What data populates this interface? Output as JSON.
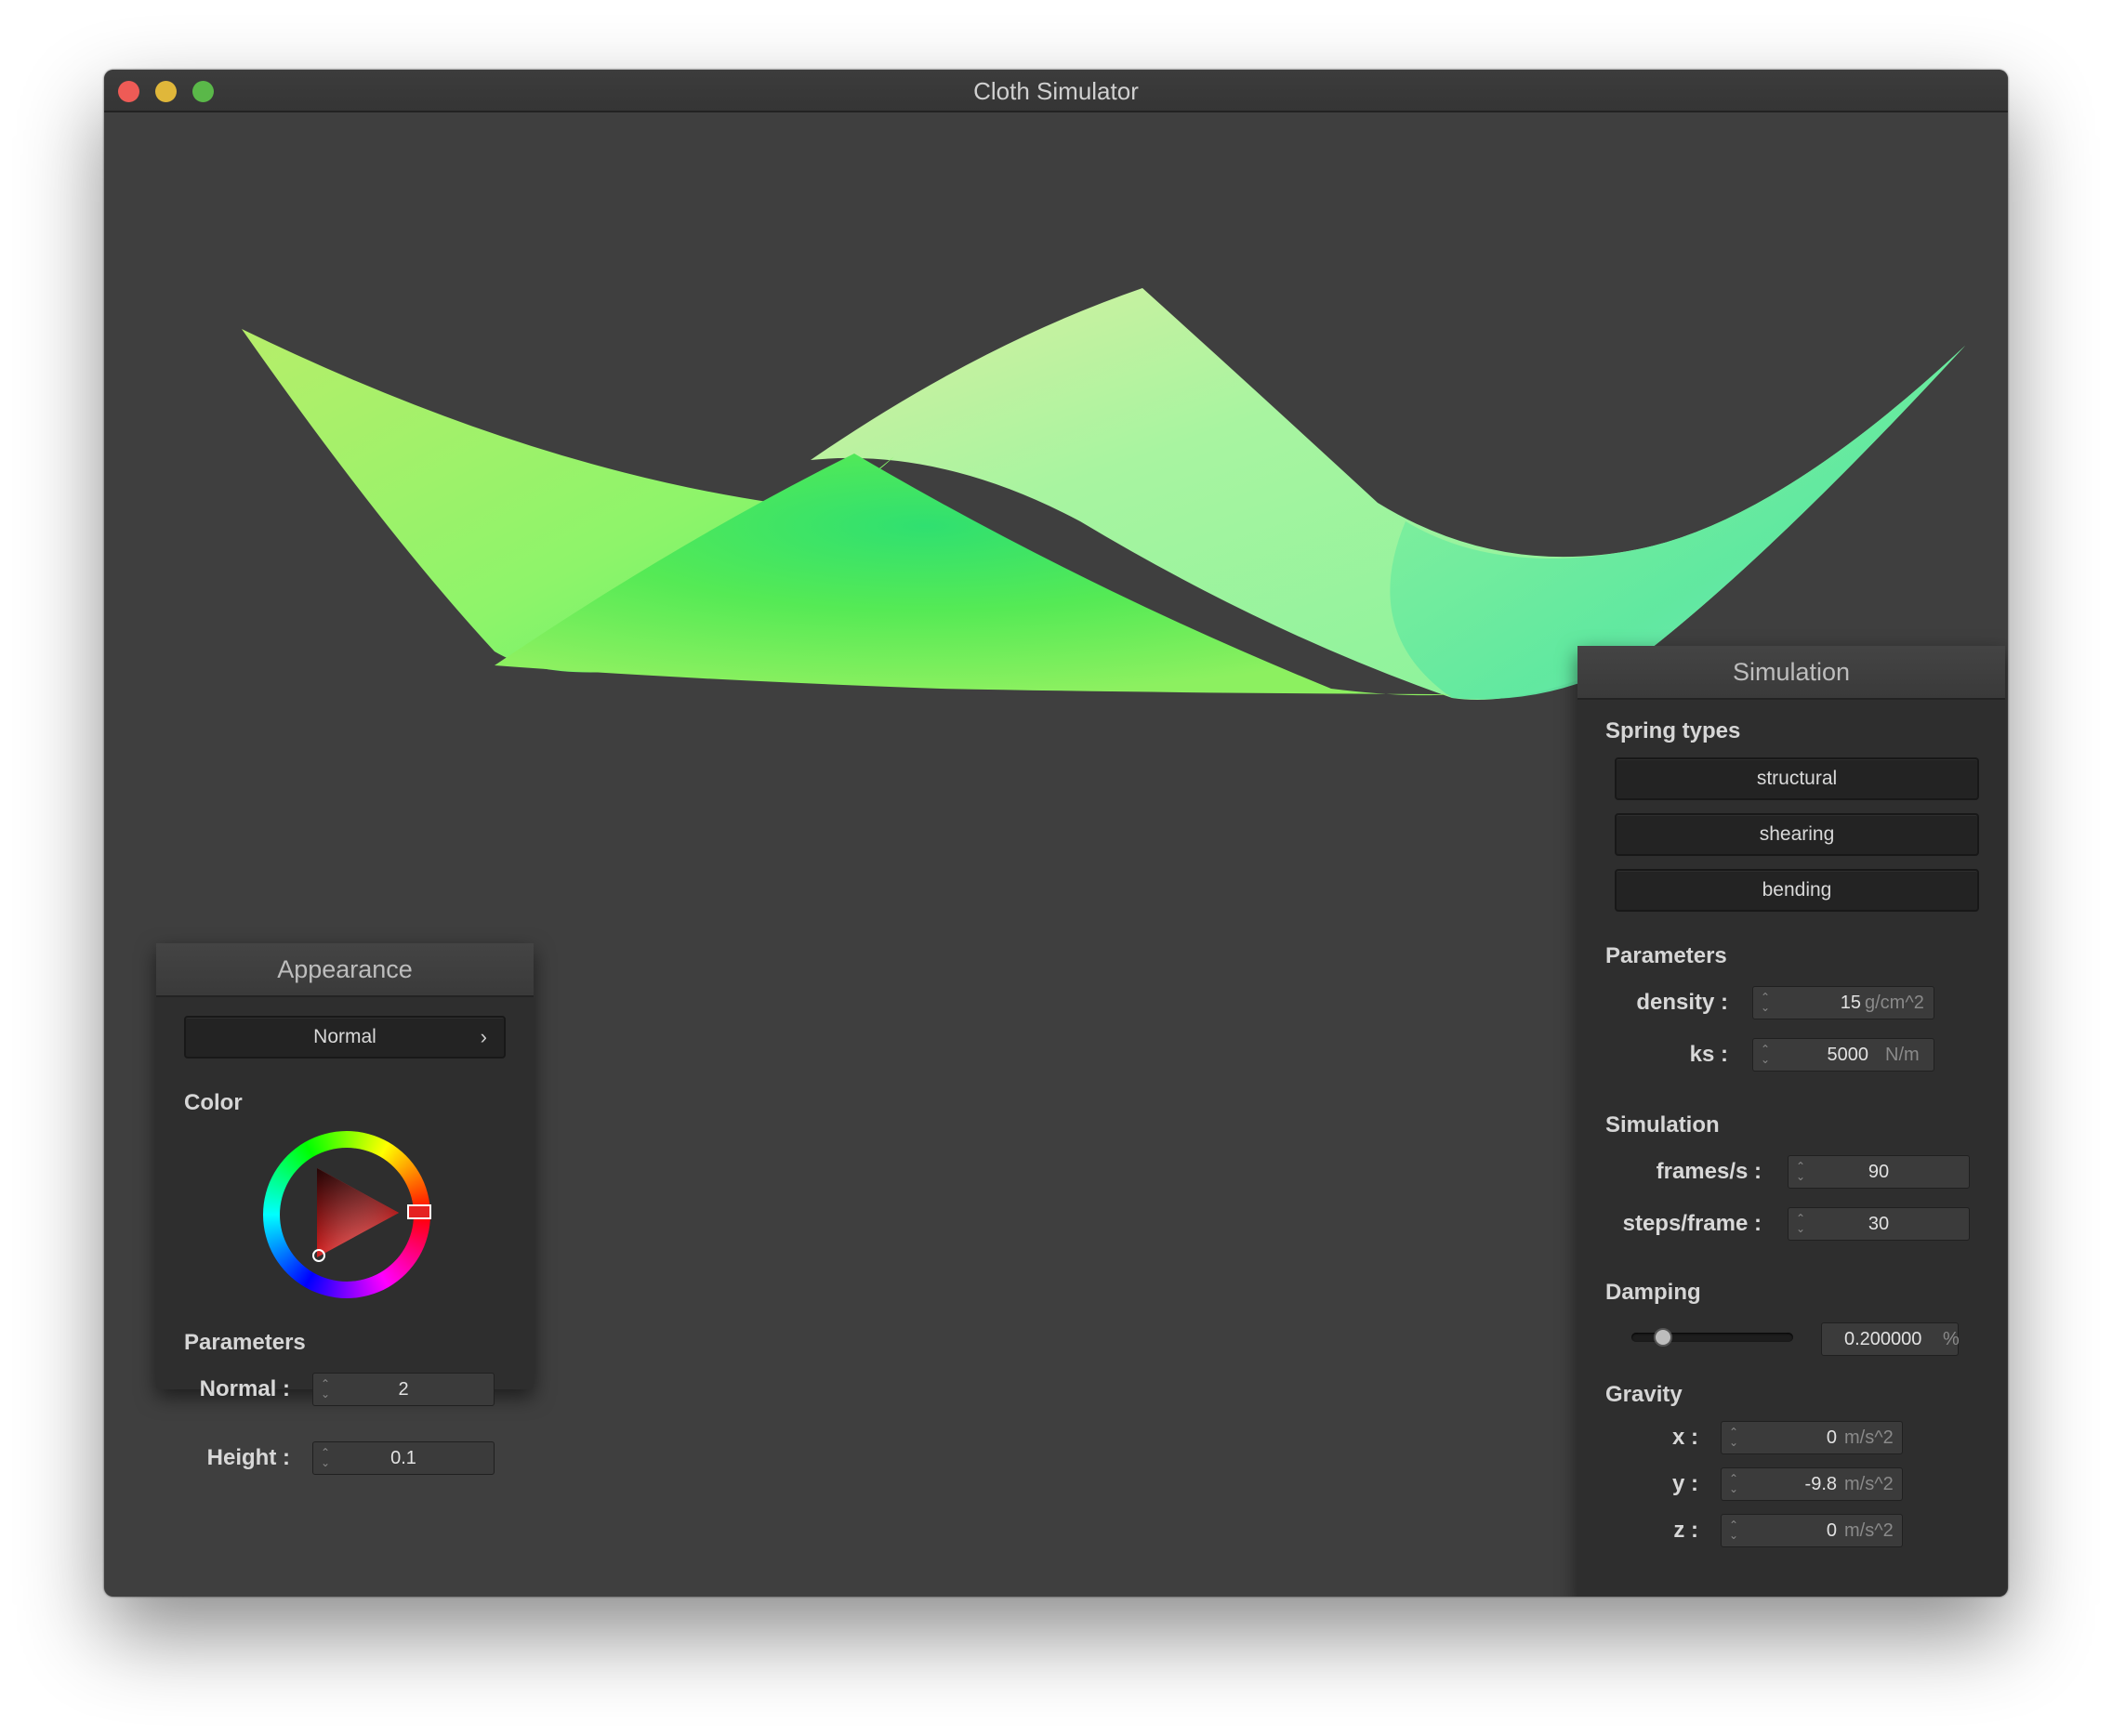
{
  "window": {
    "title": "Cloth Simulator"
  },
  "appearance": {
    "title": "Appearance",
    "shader_select": "Normal",
    "color_label": "Color",
    "color_value": "#e02424",
    "parameters_label": "Parameters",
    "normal_label": "Normal :",
    "normal_value": "2",
    "height_label": "Height :",
    "height_value": "0.1"
  },
  "simulation": {
    "title": "Simulation",
    "spring_types_label": "Spring types",
    "spring_buttons": [
      "structural",
      "shearing",
      "bending"
    ],
    "parameters_label": "Parameters",
    "density_label": "density :",
    "density_value": "15",
    "density_unit": "g/cm^2",
    "ks_label": "ks :",
    "ks_value": "5000",
    "ks_unit": "N/m",
    "simulation_label": "Simulation",
    "fps_label": "frames/s :",
    "fps_value": "90",
    "steps_label": "steps/frame :",
    "steps_value": "30",
    "damping_label": "Damping",
    "damping_value": "0.200000",
    "damping_unit": "%",
    "damping_slider_fraction": 0.2,
    "gravity_label": "Gravity",
    "gx_label": "x :",
    "gx_value": "0",
    "gy_label": "y :",
    "gy_value": "-9.8",
    "gz_label": "z :",
    "gz_value": "0",
    "gravity_unit": "m/s^2"
  }
}
